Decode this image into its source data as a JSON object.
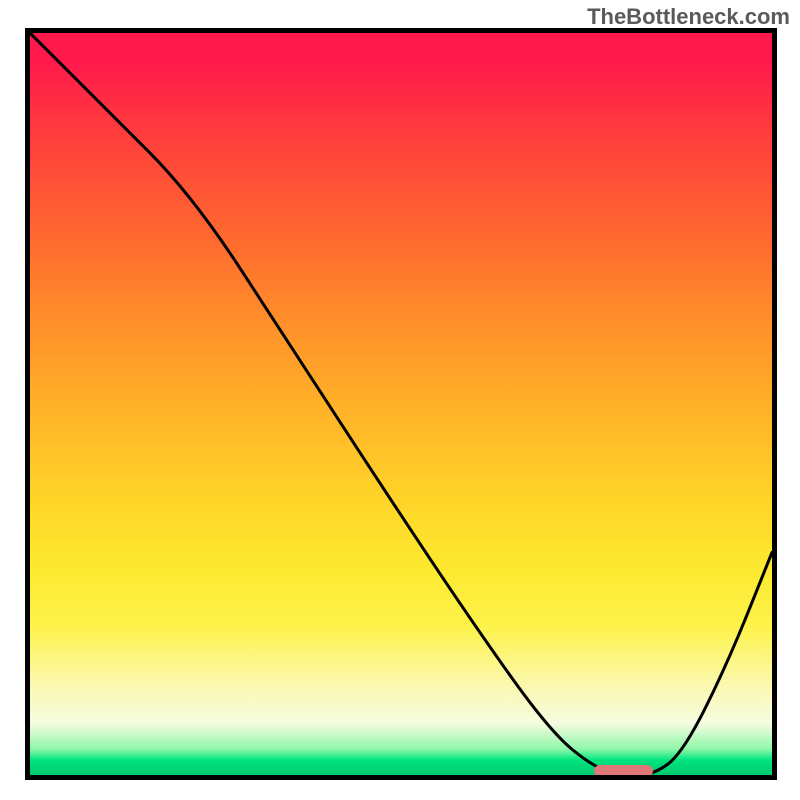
{
  "watermark": "TheBottleneck.com",
  "chart_data": {
    "type": "line",
    "title": "",
    "xlabel": "",
    "ylabel": "",
    "xlim": [
      0,
      100
    ],
    "ylim": [
      0,
      100
    ],
    "grid": false,
    "series": [
      {
        "name": "curve",
        "x": [
          0,
          10,
          22,
          35,
          48,
          60,
          70,
          76,
          80,
          84,
          88,
          94,
          100
        ],
        "values": [
          100,
          90,
          78,
          58,
          38,
          20,
          6,
          1,
          0,
          0,
          3,
          15,
          30
        ]
      }
    ],
    "marker": {
      "x_start": 76,
      "x_end": 84,
      "y": 0,
      "color": "#e07878"
    },
    "gradient": {
      "top": "#ff1a4b",
      "mid": "#ffd228",
      "bottom": "#00c86e"
    }
  }
}
